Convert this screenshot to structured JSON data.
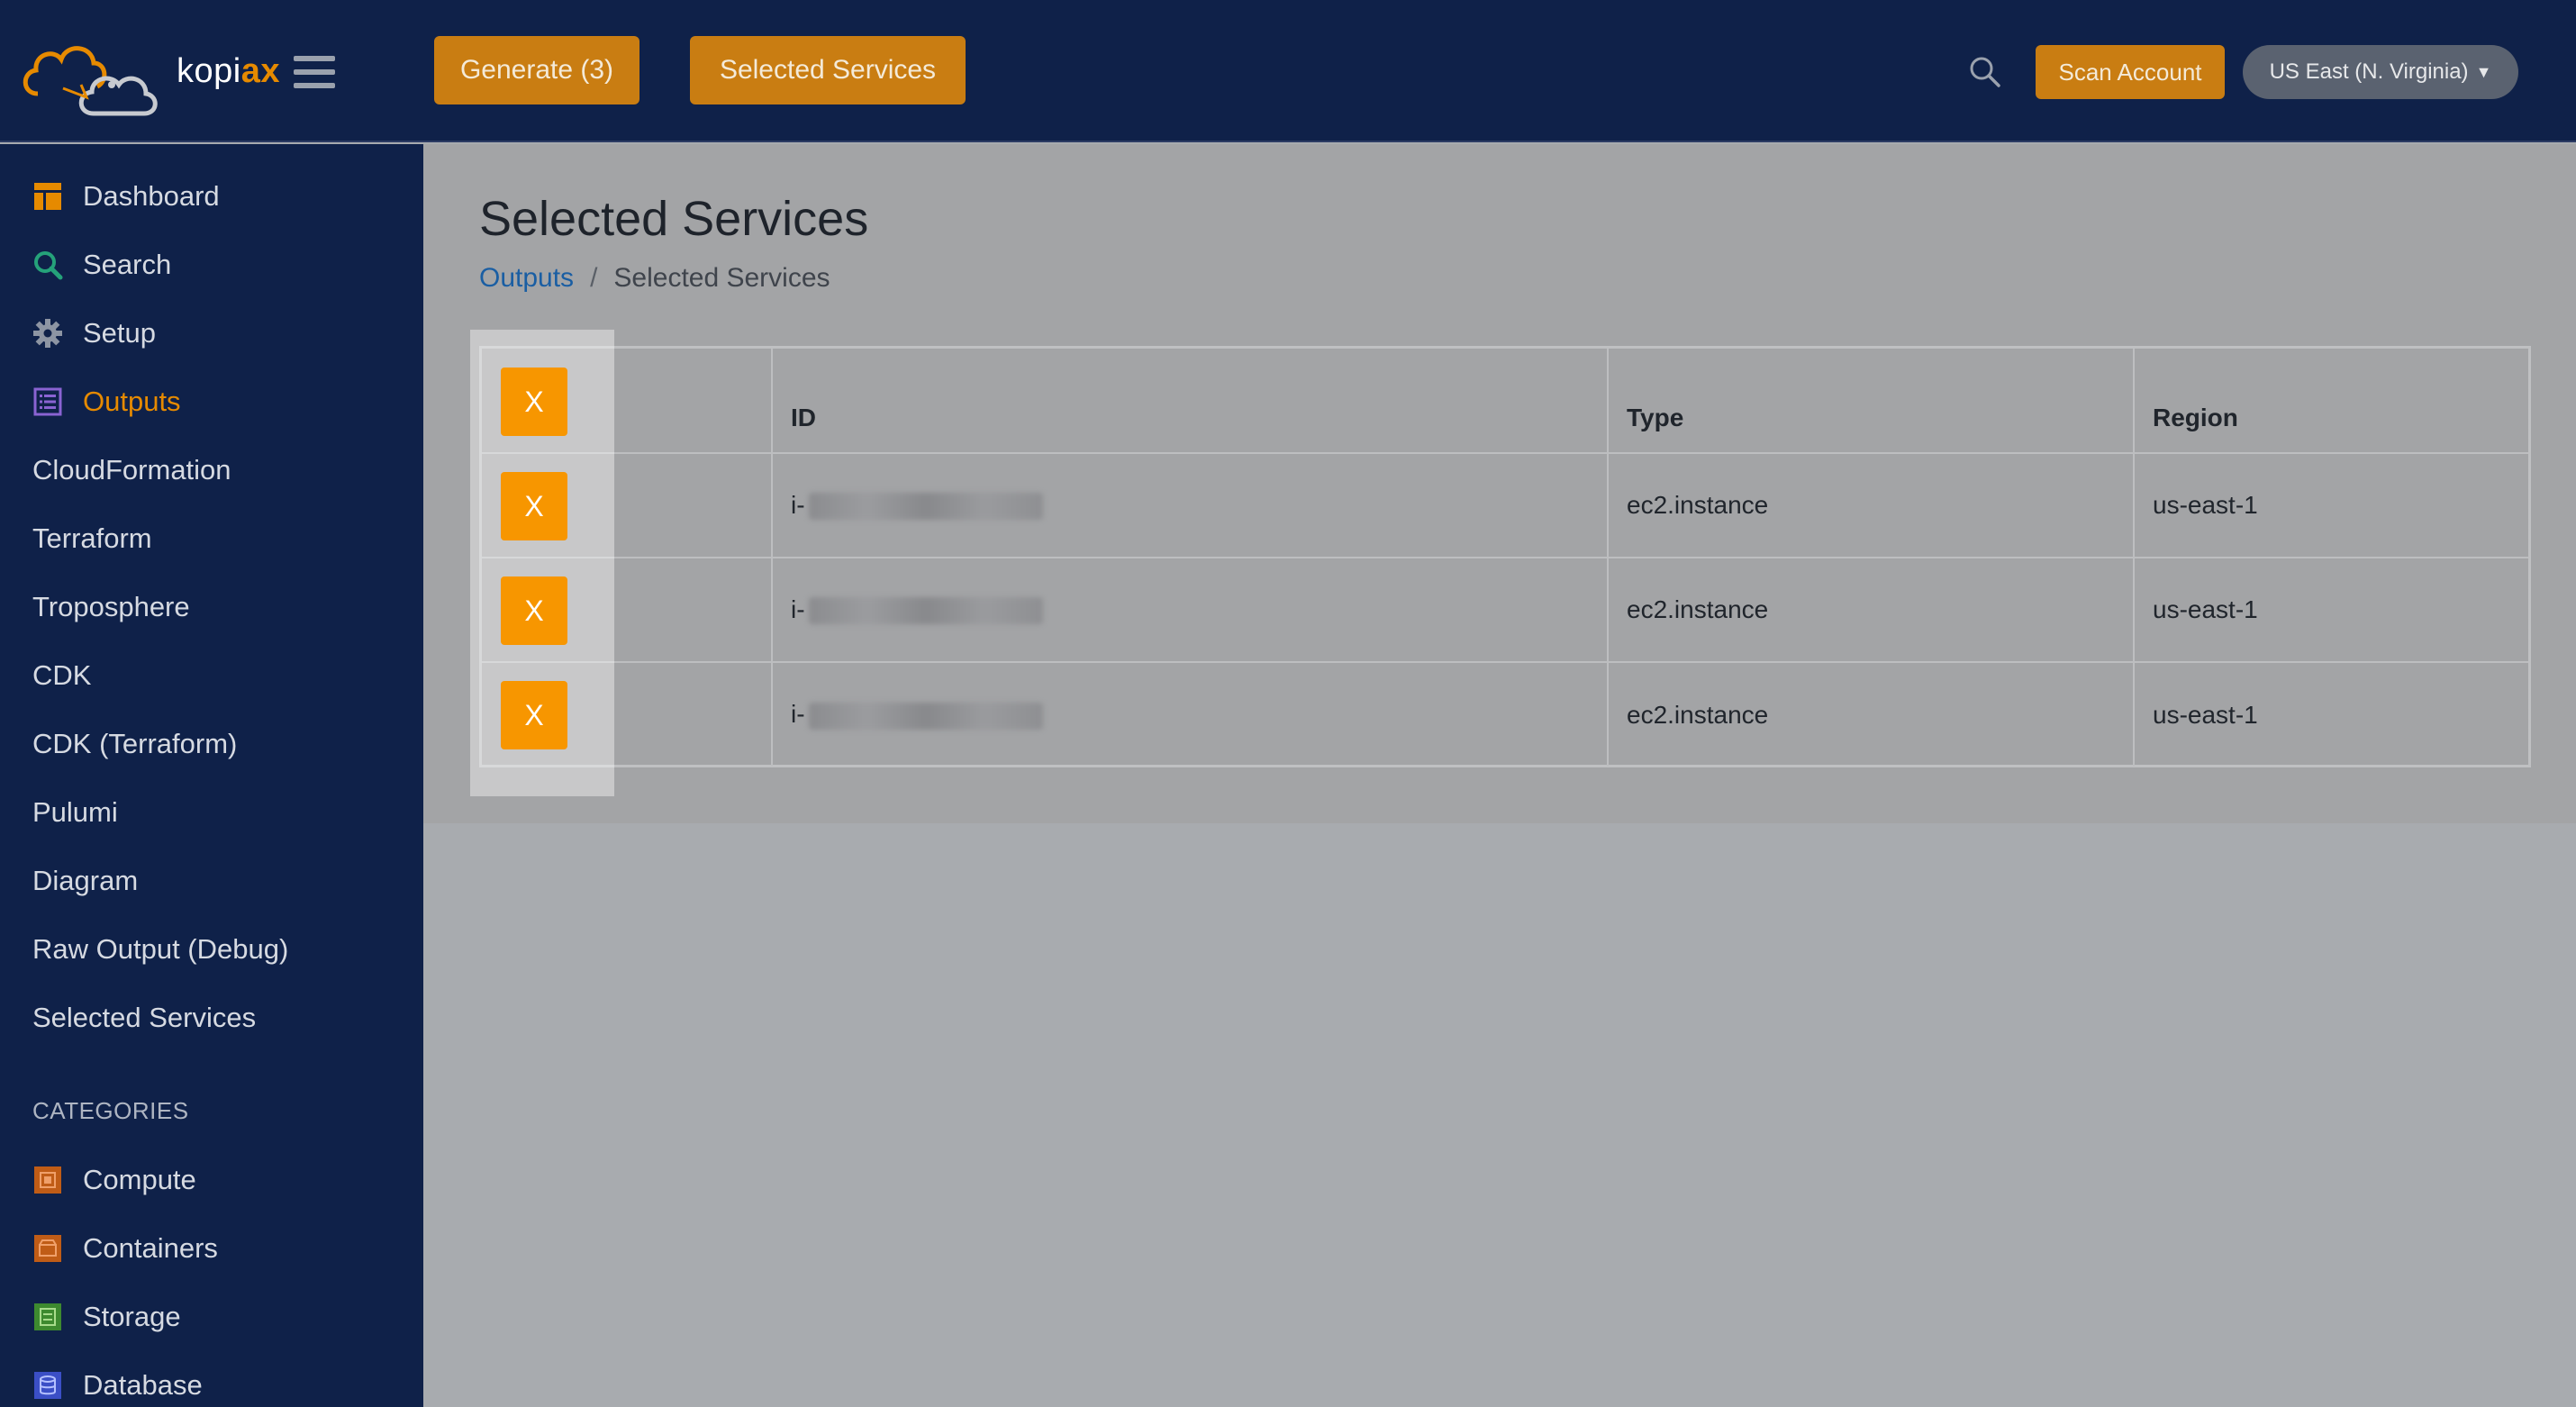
{
  "brand": {
    "name_prefix": "kopi",
    "name_accent": "ax"
  },
  "header": {
    "generate_label": "Generate (3)",
    "selected_services_label": "Selected Services",
    "scan_label": "Scan Account",
    "region_label": "US East (N. Virginia)",
    "colors": {
      "bar": "#0f2149",
      "accent": "#c97d12"
    }
  },
  "sidebar": {
    "items": [
      {
        "label": "Dashboard",
        "icon": "dashboard-icon"
      },
      {
        "label": "Search",
        "icon": "search-icon"
      },
      {
        "label": "Setup",
        "icon": "gear-icon"
      },
      {
        "label": "Outputs",
        "icon": "list-icon",
        "active": true
      },
      {
        "label": "CloudFormation"
      },
      {
        "label": "Terraform"
      },
      {
        "label": "Troposphere"
      },
      {
        "label": "CDK"
      },
      {
        "label": "CDK (Terraform)"
      },
      {
        "label": "Pulumi"
      },
      {
        "label": "Diagram"
      },
      {
        "label": "Raw Output (Debug)"
      },
      {
        "label": "Selected Services"
      }
    ],
    "categories_heading": "CATEGORIES",
    "categories": [
      {
        "label": "Compute",
        "icon": "compute-icon"
      },
      {
        "label": "Containers",
        "icon": "containers-icon"
      },
      {
        "label": "Storage",
        "icon": "storage-icon"
      },
      {
        "label": "Database",
        "icon": "database-icon"
      }
    ]
  },
  "main": {
    "title": "Selected Services",
    "breadcrumb": {
      "parent": "Outputs",
      "separator": "/",
      "current": "Selected Services"
    },
    "table": {
      "headers": [
        "",
        "ID",
        "Type",
        "Region"
      ],
      "remove_label": "X",
      "rows": [
        {
          "id_prefix": "i-",
          "type": "ec2.instance",
          "region": "us-east-1"
        },
        {
          "id_prefix": "i-",
          "type": "ec2.instance",
          "region": "us-east-1"
        },
        {
          "id_prefix": "i-",
          "type": "ec2.instance",
          "region": "us-east-1"
        }
      ]
    }
  }
}
